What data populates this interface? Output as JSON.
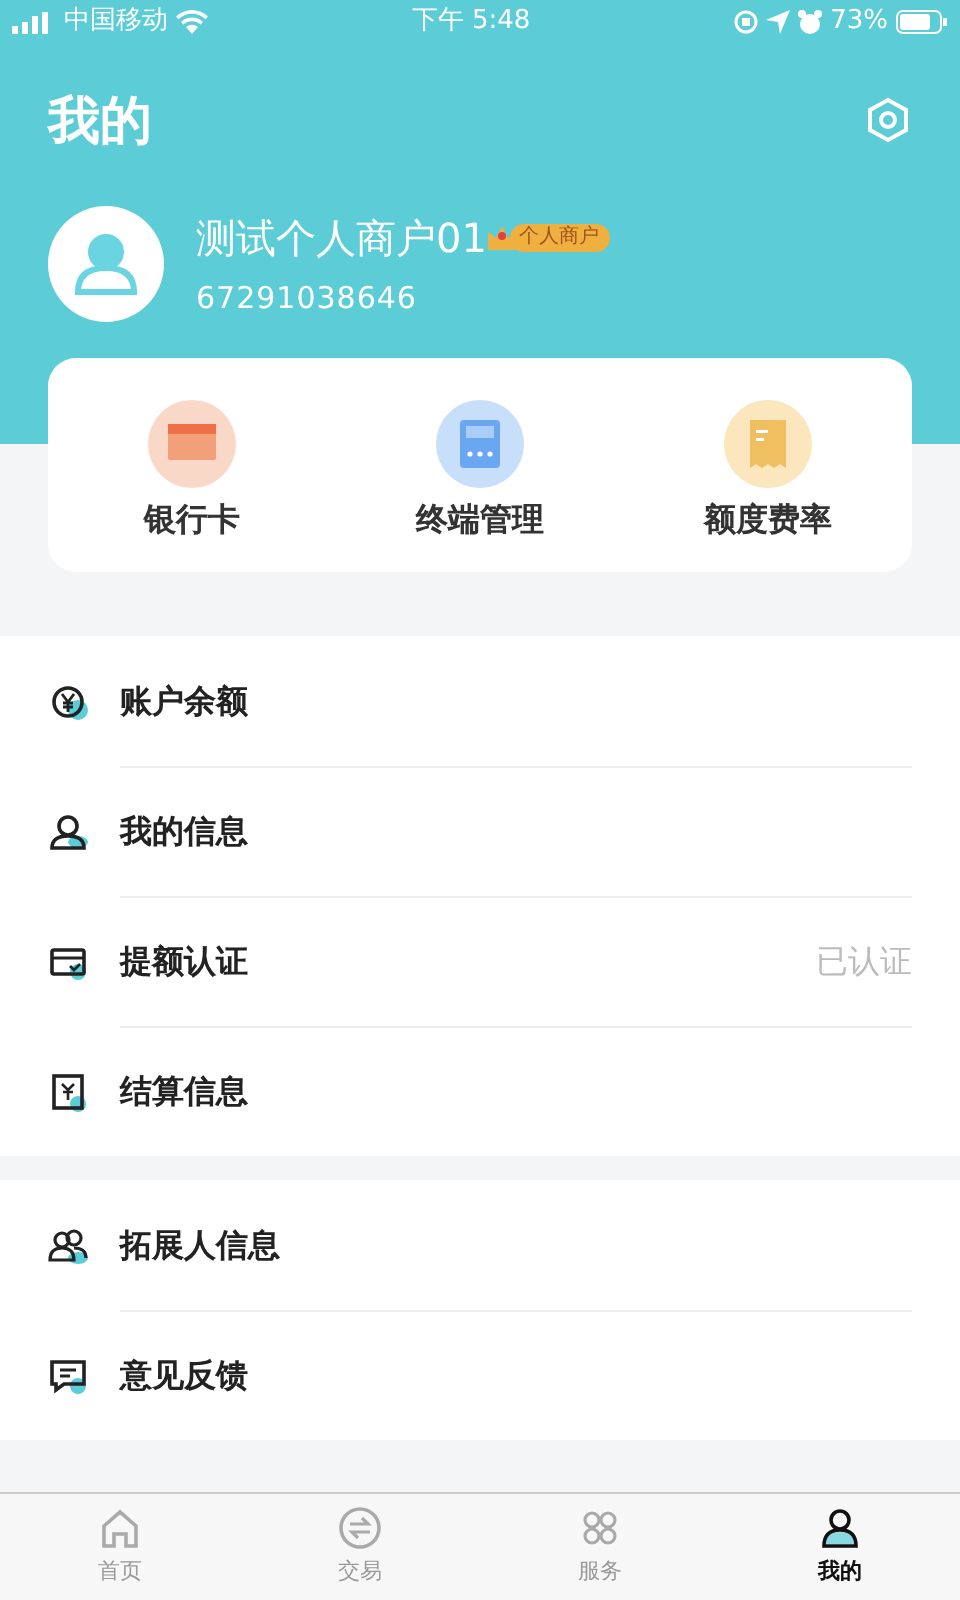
{
  "status_bar": {
    "carrier": "中国移动",
    "time": "下午 5:48",
    "battery": "73%"
  },
  "header": {
    "title": "我的"
  },
  "profile": {
    "name": "测试个人商户01",
    "badge": "个人商户",
    "account": "67291038646"
  },
  "shortcuts": [
    {
      "label": "银行卡"
    },
    {
      "label": "终端管理"
    },
    {
      "label": "额度费率"
    }
  ],
  "menu_groups": [
    {
      "items": [
        {
          "label": "账户余额"
        },
        {
          "label": "我的信息"
        },
        {
          "label": "提额认证",
          "value": "已认证"
        },
        {
          "label": "结算信息"
        }
      ]
    },
    {
      "items": [
        {
          "label": "拓展人信息"
        },
        {
          "label": "意见反馈"
        }
      ]
    }
  ],
  "tab_bar": [
    {
      "label": "首页",
      "selected": false
    },
    {
      "label": "交易",
      "selected": false
    },
    {
      "label": "服务",
      "selected": false
    },
    {
      "label": "我的",
      "selected": true
    }
  ]
}
